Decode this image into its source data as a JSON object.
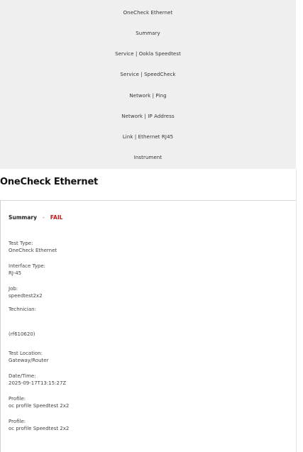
{
  "nav": {
    "items": [
      "OneCheck Ethernet",
      "Summary",
      "Service | Ookla Speedtest",
      "Service | SpeedCheck",
      "Network | Ping",
      "Network | IP Address",
      "Link | Ethernet RJ45",
      "Instrument"
    ]
  },
  "header": {
    "title": "OneCheck Ethernet"
  },
  "summary": {
    "label": "Summary",
    "separator": "-",
    "status": "FAIL",
    "status_color": "#b71c1c"
  },
  "fields": [
    {
      "label": "Test Type:",
      "value": "OneCheck Ethernet"
    },
    {
      "label": "Interface Type:",
      "value": "RJ-45"
    },
    {
      "label": "Job:",
      "value": "speedtest2x2"
    },
    {
      "label": "Technician:",
      "value": ""
    },
    {
      "label": "",
      "value": "(rf610620)"
    },
    {
      "label": "Test Location:",
      "value": "Gateway/Router"
    },
    {
      "label": "Date/Time:",
      "value": "2025-09-17T13:15:27Z"
    },
    {
      "label": "Profile:",
      "value": "oc profile Speedtest 2x2"
    },
    {
      "label": "Profile:",
      "value": "oc profile Speedtest 2x2"
    }
  ]
}
